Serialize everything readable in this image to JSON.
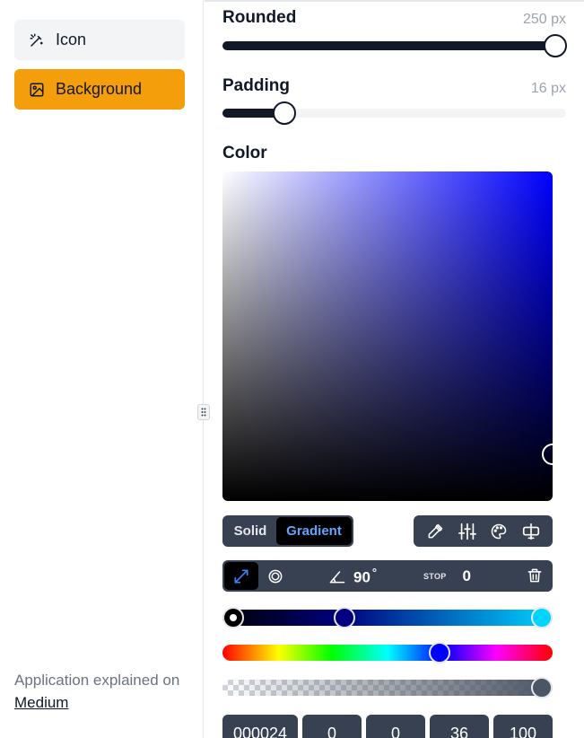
{
  "sidebar": {
    "items": [
      {
        "label": "Icon",
        "icon": "magic-wand-icon"
      },
      {
        "label": "Background",
        "icon": "image-icon",
        "active": true
      }
    ],
    "footer_text": "Application explained on",
    "footer_link": "Medium",
    "active_color": "#f59e0b"
  },
  "rounded": {
    "label": "Rounded",
    "value": "250 px",
    "fraction": 1.0
  },
  "padding": {
    "label": "Padding",
    "value": "16 px",
    "fraction": 0.18
  },
  "color": {
    "label": "Color",
    "base_hue_color": "#0000ff",
    "mode": {
      "solid": "Solid",
      "gradient": "Gradient",
      "selected": "Gradient"
    },
    "tools": [
      "eyedropper-icon",
      "sliders-icon",
      "palette-icon",
      "compare-icon"
    ],
    "gradient": {
      "types": [
        "linear-icon",
        "radial-icon"
      ],
      "active_type": "linear",
      "angle": "90",
      "degree": "°",
      "stop_label": "STOP",
      "stop_value": "0",
      "stops": [
        {
          "color": "#000000",
          "position": 0
        },
        {
          "color": "#000080",
          "position": 0.36
        },
        {
          "color": "#00d4ff",
          "position": 1.0
        }
      ]
    },
    "hue_fraction": 0.67,
    "alpha_fraction": 1.0,
    "inputs": {
      "hex": "000024",
      "r": "0",
      "g": "0",
      "b": "36",
      "a": "100"
    }
  }
}
